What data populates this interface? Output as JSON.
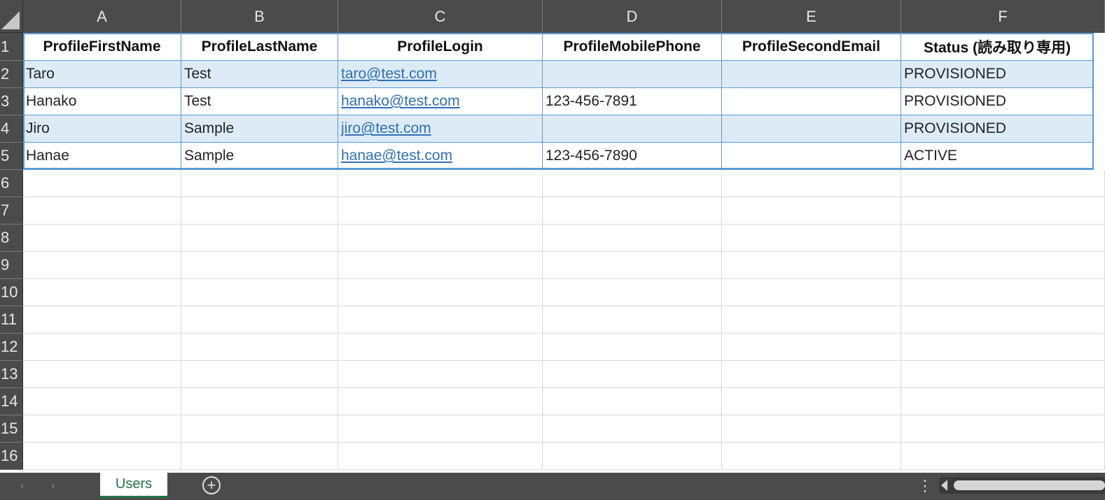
{
  "sheet": {
    "columns": [
      "A",
      "B",
      "C",
      "D",
      "E",
      "F"
    ],
    "rows": [
      "1",
      "2",
      "3",
      "4",
      "5",
      "6",
      "7",
      "8",
      "9",
      "10",
      "11",
      "12",
      "13",
      "14",
      "15",
      "16"
    ],
    "headers": [
      "ProfileFirstName",
      "ProfileLastName",
      "ProfileLogin",
      "ProfileMobilePhone",
      "ProfileSecondEmail",
      "Status (読み取り専用)"
    ],
    "data": [
      [
        "Taro",
        "Test",
        "taro@test.com",
        "",
        "",
        "PROVISIONED"
      ],
      [
        "Hanako",
        "Test",
        "hanako@test.com",
        "123-456-7891",
        "",
        "PROVISIONED"
      ],
      [
        "Jiro",
        "Sample",
        "jiro@test.com",
        "",
        "",
        "PROVISIONED"
      ],
      [
        "Hanae",
        "Sample",
        "hanae@test.com",
        "123-456-7890",
        "",
        "ACTIVE"
      ]
    ]
  },
  "tabs": {
    "active": "Users"
  },
  "icons": {
    "prev_sheet": "chevron-left-icon",
    "next_sheet": "chevron-right-icon",
    "add_sheet": "plus-circle-icon",
    "more": "vertical-dots-icon",
    "scroll_left": "triangle-left-icon"
  },
  "colors": {
    "header_bg": "#4b4b4b",
    "band_fill": "#ddebf7",
    "table_border": "#5b9bd5",
    "link": "#2f6fb7",
    "tab_accent": "#217346"
  }
}
